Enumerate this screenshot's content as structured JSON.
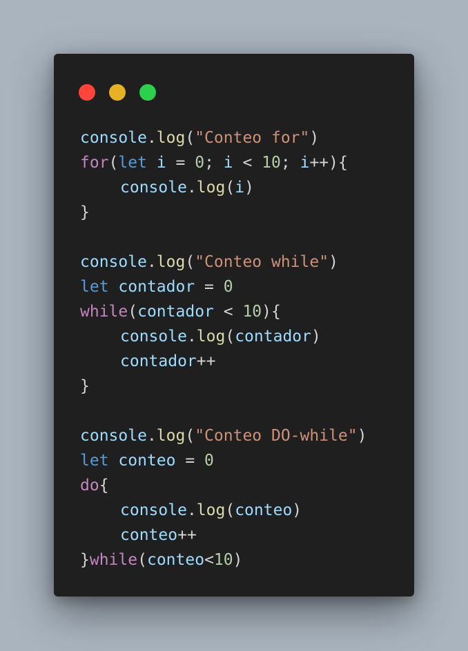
{
  "window": {
    "controls": [
      {
        "name": "close",
        "color": "#ff453a"
      },
      {
        "name": "minimize",
        "color": "#e6b221"
      },
      {
        "name": "zoom",
        "color": "#2bd14b"
      }
    ]
  },
  "code": {
    "strings": {
      "for_label": "\"Conteo for\"",
      "while_label": "\"Conteo while\"",
      "do_label": "\"Conteo DO-while\""
    },
    "keywords": {
      "for": "for",
      "while": "while",
      "do": "do",
      "let": "let"
    },
    "identifiers": {
      "console": "console",
      "log": "log",
      "i": "i",
      "contador": "contador",
      "conteo": "conteo"
    },
    "numbers": {
      "zero": "0",
      "ten": "10"
    }
  }
}
